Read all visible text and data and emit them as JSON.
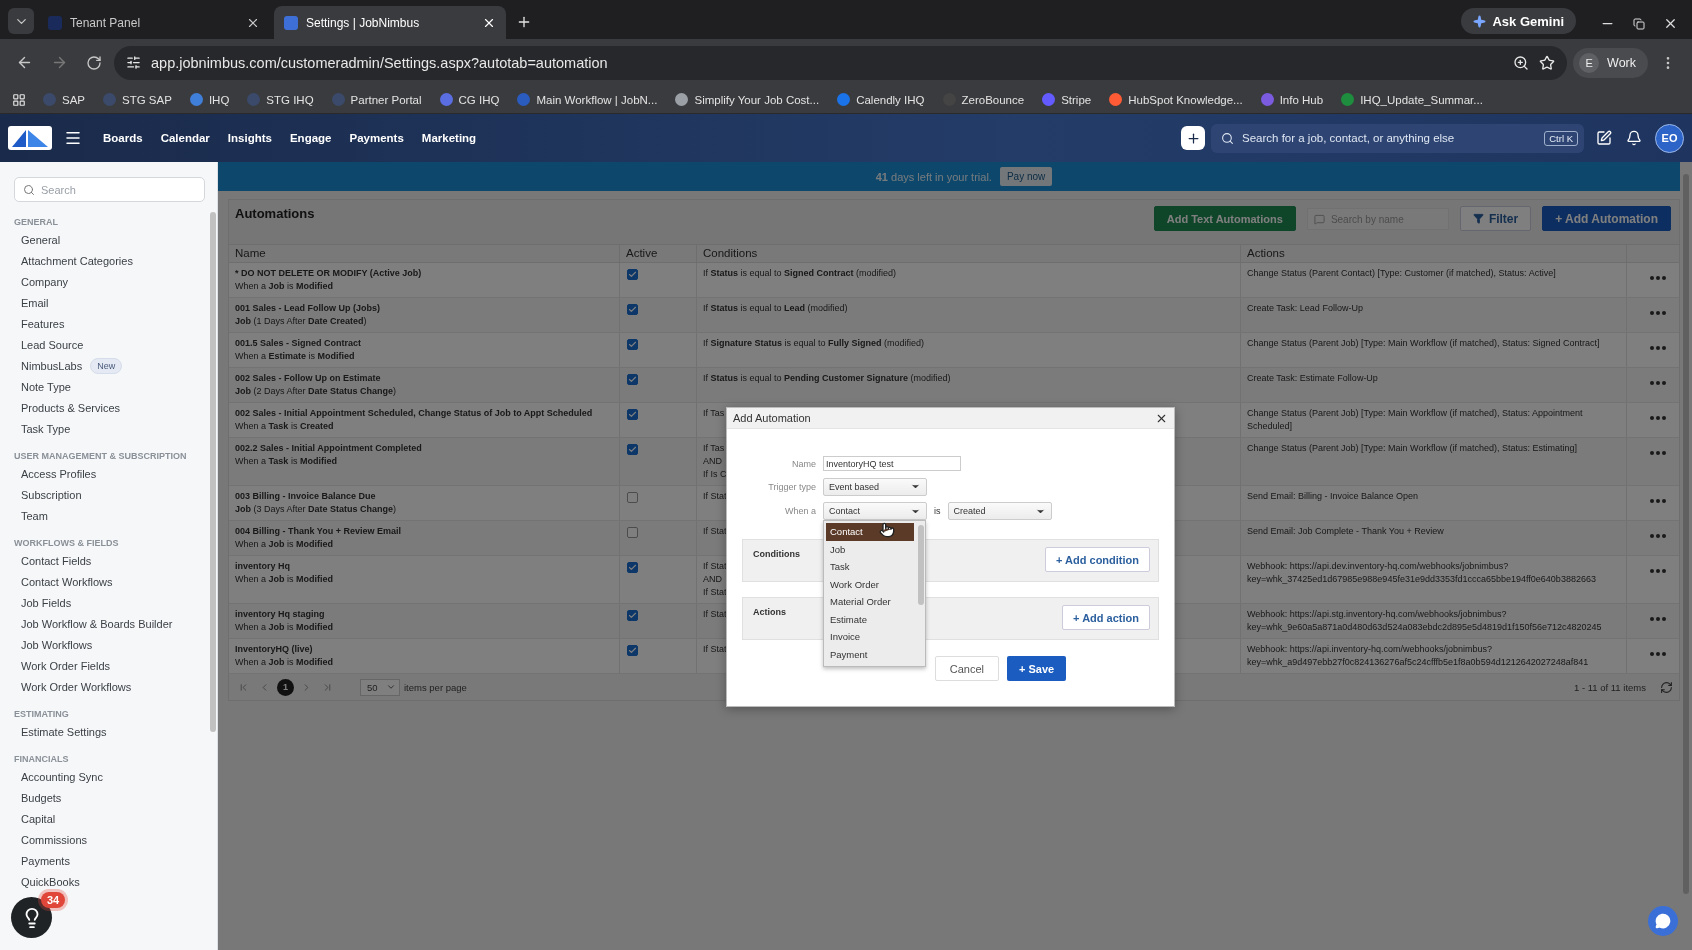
{
  "browser": {
    "tabs": [
      {
        "title": "Tenant Panel",
        "selected": false
      },
      {
        "title": "Settings | JobNimbus",
        "selected": true
      }
    ],
    "ask_gemini": "Ask Gemini",
    "address": "app.jobnimbus.com/customeradmin/Settings.aspx?autotab=automation",
    "profile": {
      "initial": "E",
      "label": "Work"
    },
    "bookmarks": [
      {
        "label": "SAP",
        "color": "#3b4a6b"
      },
      {
        "label": "STG SAP",
        "color": "#3b4a6b"
      },
      {
        "label": "IHQ",
        "color": "#3f7fd9"
      },
      {
        "label": "STG IHQ",
        "color": "#3b4a6b"
      },
      {
        "label": "Partner Portal",
        "color": "#3b4a6b"
      },
      {
        "label": "CG IHQ",
        "color": "#5b6ee1"
      },
      {
        "label": "Main Workflow | JobN...",
        "color": "#2a5cc0"
      },
      {
        "label": "Simplify Your Job Cost...",
        "color": "#9aa0a6"
      },
      {
        "label": "Calendly IHQ",
        "color": "#1a73e8"
      },
      {
        "label": "ZeroBounce",
        "color": "#444444"
      },
      {
        "label": "Stripe",
        "color": "#635bff"
      },
      {
        "label": "HubSpot Knowledge...",
        "color": "#ff5c35"
      },
      {
        "label": "Info Hub",
        "color": "#7b5be0"
      },
      {
        "label": "IHQ_Update_Summar...",
        "color": "#1e8e3e"
      }
    ]
  },
  "nav": {
    "items": [
      "Boards",
      "Calendar",
      "Insights",
      "Engage",
      "Payments",
      "Marketing"
    ],
    "search_placeholder": "Search for a job, contact, or anything else",
    "shortcut": "Ctrl K",
    "avatar": "EO"
  },
  "sidebar": {
    "search_placeholder": "Search",
    "sections": [
      {
        "heading": "GENERAL",
        "items": [
          {
            "label": "General"
          },
          {
            "label": "Attachment Categories"
          },
          {
            "label": "Company"
          },
          {
            "label": "Email"
          },
          {
            "label": "Features"
          },
          {
            "label": "Lead Source"
          },
          {
            "label": "NimbusLabs",
            "badge": "New"
          },
          {
            "label": "Note Type"
          },
          {
            "label": "Products & Services"
          },
          {
            "label": "Task Type"
          }
        ]
      },
      {
        "heading": "USER MANAGEMENT & SUBSCRIPTION",
        "items": [
          {
            "label": "Access Profiles"
          },
          {
            "label": "Subscription"
          },
          {
            "label": "Team"
          }
        ]
      },
      {
        "heading": "WORKFLOWS & FIELDS",
        "items": [
          {
            "label": "Contact Fields"
          },
          {
            "label": "Contact Workflows"
          },
          {
            "label": "Job Fields"
          },
          {
            "label": "Job Workflow & Boards Builder"
          },
          {
            "label": "Job Workflows"
          },
          {
            "label": "Work Order Fields"
          },
          {
            "label": "Work Order Workflows"
          }
        ]
      },
      {
        "heading": "ESTIMATING",
        "items": [
          {
            "label": "Estimate Settings"
          }
        ]
      },
      {
        "heading": "FINANCIALS",
        "items": [
          {
            "label": "Accounting Sync"
          },
          {
            "label": "Budgets"
          },
          {
            "label": "Capital"
          },
          {
            "label": "Commissions"
          },
          {
            "label": "Payments"
          },
          {
            "label": "QuickBooks"
          }
        ]
      }
    ]
  },
  "banner": {
    "text": "**41** days left in your trial.",
    "button": "Pay now"
  },
  "automations": {
    "title": "Automations",
    "text_button": "Add Text Automations",
    "search_placeholder": "Search by name",
    "filter": "Filter",
    "add": "+ Add Automation"
  },
  "table": {
    "columns": [
      "Name",
      "Active",
      "Conditions",
      "Actions"
    ],
    "rows": [
      {
        "name": "* DO NOT DELETE OR MODIFY (Active Job)",
        "trigger": "When a **Job** is **Modified**",
        "active": true,
        "conditions": [
          "If **Status** is equal to **Signed Contract** (modified)"
        ],
        "actions": [
          "Change Status (Parent Contact) [Type: Customer (if matched), Status: Active]"
        ]
      },
      {
        "name": "001 Sales - Lead Follow Up (Jobs)",
        "trigger": "**Job** (1 Days After **Date Created**)",
        "active": true,
        "conditions": [
          "If **Status** is equal to **Lead** (modified)"
        ],
        "actions": [
          "Create Task: Lead Follow-Up"
        ]
      },
      {
        "name": "001.5 Sales - Signed Contract",
        "trigger": "When a **Estimate** is **Modified**",
        "active": true,
        "conditions": [
          "If **Signature Status** is equal to **Fully Signed** (modified)"
        ],
        "actions": [
          "Change Status (Parent Job) [Type: Main Workflow (if matched), Status: Signed Contract]"
        ]
      },
      {
        "name": "002 Sales - Follow Up on Estimate",
        "trigger": "**Job** (2 Days After **Date Status Change**)",
        "active": true,
        "conditions": [
          "If **Status** is equal to **Pending Customer Signature** (modified)"
        ],
        "actions": [
          "Create Task: Estimate Follow-Up"
        ]
      },
      {
        "name": "002 Sales - Initial Appointment Scheduled, Change Status of Job to Appt Scheduled",
        "trigger": "When a **Task** is **Created**",
        "active": true,
        "conditions": [
          "If Tas"
        ],
        "actions": [
          "Change Status (Parent Job) [Type: Main Workflow (if matched), Status: Appointment",
          "Scheduled]"
        ]
      },
      {
        "name": "002.2 Sales - Initial Appointment Completed",
        "trigger": "When a **Task** is **Modified**",
        "active": true,
        "conditions": [
          "If Tas",
          "AND",
          "If Is C"
        ],
        "actions": [
          "Change Status (Parent Job) [Type: Main Workflow (if matched), Status: Estimating]"
        ]
      },
      {
        "name": "003 Billing - Invoice Balance Due",
        "trigger": "**Job** (3 Days After **Date Status Change**)",
        "active": false,
        "conditions": [
          "If Stat"
        ],
        "actions": [
          "Send Email: Billing - Invoice Balance Open"
        ]
      },
      {
        "name": "004 Billing - Thank You + Review Email",
        "trigger": "When a **Job** is **Modified**",
        "active": false,
        "conditions": [
          "If Stat"
        ],
        "actions": [
          "Send Email: Job Complete - Thank You + Review"
        ]
      },
      {
        "name": "inventory Hq",
        "trigger": "When a **Job** is **Modified**",
        "active": true,
        "conditions": [
          "If Stat",
          "AND",
          "If Stat"
        ],
        "actions": [
          "Webhook: https://api.dev.inventory-hq.com/webhooks/jobnimbus?",
          "key=whk_37425ed1d67985e988e945fe31e9dd3353fd1ccca65bbe194ff0e640b3882663"
        ]
      },
      {
        "name": "inventory Hq staging",
        "trigger": "When a **Job** is **Modified**",
        "active": true,
        "conditions": [
          "If Stat"
        ],
        "actions": [
          "Webhook: https://api.stg.inventory-hq.com/webhooks/jobnimbus?",
          "key=whk_9e60a5a871a0d480d63d524a083ebdc2d895e5d4819d1f150f56e712c4820245"
        ]
      },
      {
        "name": "InventoryHQ (live)",
        "trigger": "When a **Job** is **Modified**",
        "active": true,
        "conditions": [
          "If Stat"
        ],
        "actions": [
          "Webhook: https://api.inventory-hq.com/webhooks/jobnimbus?",
          "key=whk_a9d497ebb27f0c824136276af5c24cfffb5e1f8a0b594d1212642027248af841"
        ]
      }
    ]
  },
  "pager": {
    "page": "1",
    "page_size": "50",
    "page_size_label": "items per page",
    "summary": "1 - 11 of 11 items"
  },
  "dialog": {
    "title": "Add Automation",
    "name_label": "Name",
    "name_value": "InventoryHQ test",
    "trigger_label": "Trigger type",
    "trigger_value": "Event based",
    "when_label": "When a",
    "when_value": "Contact",
    "is_label": "is",
    "event_value": "Created",
    "options": [
      {
        "label": "Contact",
        "selected": true
      },
      {
        "label": "Job",
        "selected": false
      },
      {
        "label": "Task",
        "selected": false
      },
      {
        "label": "Work Order",
        "selected": false
      },
      {
        "label": "Material Order",
        "selected": false
      },
      {
        "label": "Estimate",
        "selected": false
      },
      {
        "label": "Invoice",
        "selected": false
      },
      {
        "label": "Payment",
        "selected": false
      }
    ],
    "conditions_label": "Conditions",
    "add_condition": "+ Add condition",
    "actions_label": "Actions",
    "add_action": "+ Add action",
    "cancel": "Cancel",
    "save": "+ Save"
  },
  "help": {
    "badge": "34"
  }
}
